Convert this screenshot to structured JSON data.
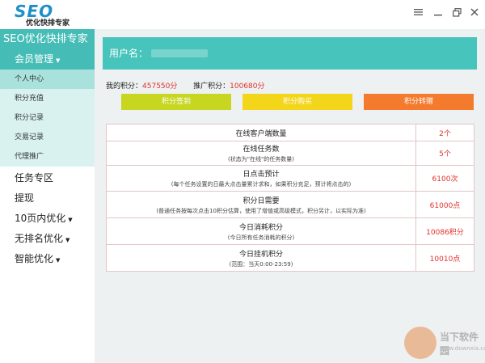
{
  "logo": {
    "brand": "SEO",
    "subtitle": "优化快排专家"
  },
  "window": {
    "menu_icon": "list-icon",
    "minimize_icon": "minimize-icon",
    "restore_icon": "restore-icon",
    "close_icon": "close-icon"
  },
  "sidebar": {
    "title": "SEO优化快排专家",
    "group": {
      "label": "会员管理"
    },
    "subitems": [
      {
        "label": "个人中心",
        "active": true
      },
      {
        "label": "积分充值"
      },
      {
        "label": "积分记录"
      },
      {
        "label": "交易记录"
      },
      {
        "label": "代理推广"
      }
    ],
    "items": [
      {
        "label": "任务专区"
      },
      {
        "label": "提现"
      },
      {
        "label": "10页内优化"
      },
      {
        "label": "无排名优化"
      },
      {
        "label": "智能优化"
      }
    ]
  },
  "main": {
    "user": {
      "label": "用户名："
    },
    "stats": {
      "my_points_label": "我的积分：",
      "my_points_value": "457550分",
      "promo_points_label": "推广积分：",
      "promo_points_value": "100680分"
    },
    "buttons": {
      "sign": "积分签到",
      "buy": "积分购买",
      "transfer": "积分转赠"
    },
    "table": [
      {
        "title": "在线客户端数量",
        "note": "",
        "value": "2个"
      },
      {
        "title": "在线任务数",
        "note": "(状态为\"在线\"的任务数量)",
        "value": "5个"
      },
      {
        "title": "日点击预计",
        "note": "(每个任务设置的日最大点击量累计求和，如果积分充足，预计将点击的)",
        "value": "6100次"
      },
      {
        "title": "积分日需要",
        "note": "(普通任务按每次点击10积分估算，使用了增值或高级模式，积分另计，以实际为准)",
        "value": "61000点"
      },
      {
        "title": "今日消耗积分",
        "note": "(今日所有任务消耗的积分)",
        "value": "10086积分"
      },
      {
        "title": "今日挂机积分",
        "note": "(范围：当天0:00-23:59)",
        "value": "10010点"
      }
    ]
  },
  "watermark": {
    "text": "当下软件园",
    "url": "www.downxia.com"
  },
  "colors": {
    "teal": "#45bdb6",
    "red": "#e0312c",
    "green_btn": "#c6d621",
    "yellow_btn": "#f3d51a",
    "orange_btn": "#f47a2e"
  }
}
